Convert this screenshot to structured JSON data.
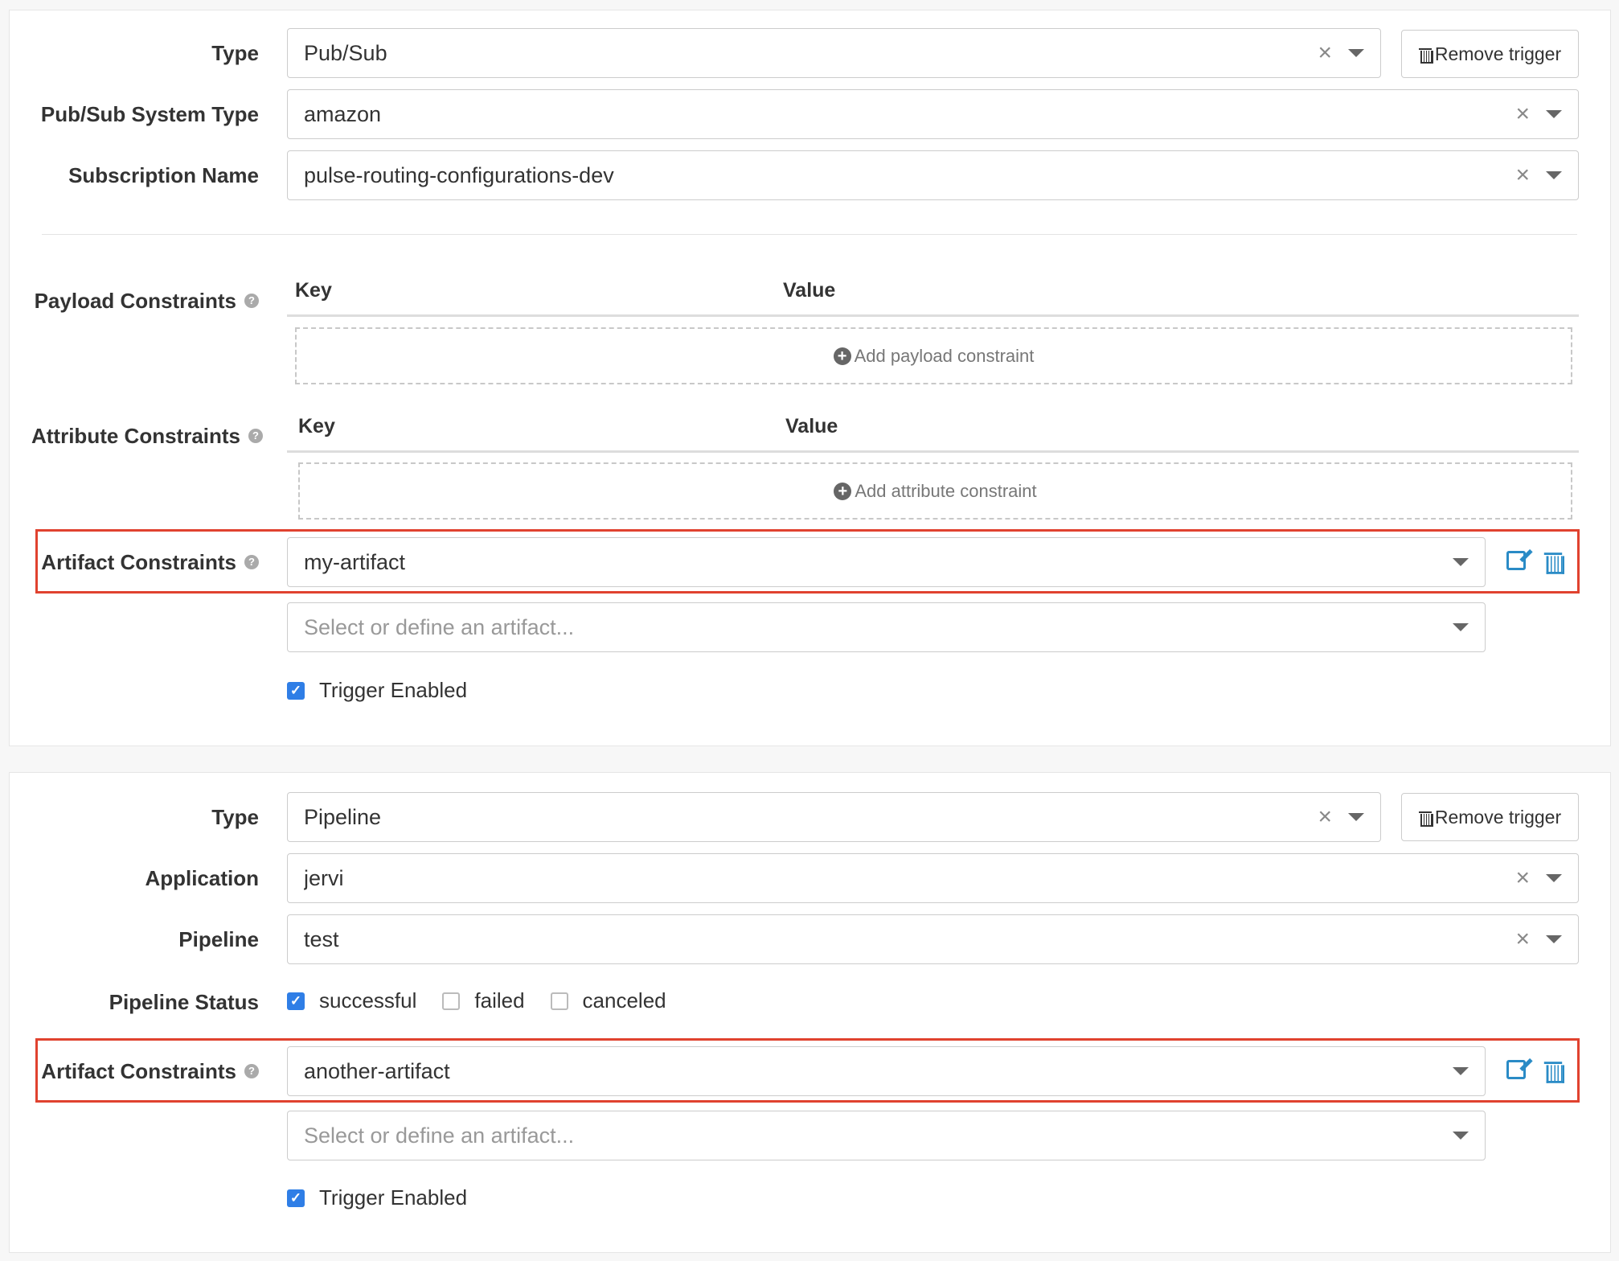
{
  "trigger1": {
    "type_label": "Type",
    "type_value": "Pub/Sub",
    "remove_label": "Remove trigger",
    "pubsub_type_label": "Pub/Sub System Type",
    "pubsub_type_value": "amazon",
    "subscription_label": "Subscription Name",
    "subscription_value": "pulse-routing-configurations-dev",
    "payload_label": "Payload Constraints",
    "payload_key_header": "Key",
    "payload_value_header": "Value",
    "add_payload_label": "Add payload constraint",
    "attribute_label": "Attribute Constraints",
    "attribute_key_header": "Key",
    "attribute_value_header": "Value",
    "add_attribute_label": "Add attribute constraint",
    "artifact_label": "Artifact Constraints",
    "artifact_value": "my-artifact",
    "artifact_placeholder": "Select or define an artifact...",
    "enabled_label": "Trigger Enabled"
  },
  "trigger2": {
    "type_label": "Type",
    "type_value": "Pipeline",
    "remove_label": "Remove trigger",
    "application_label": "Application",
    "application_value": "jervi",
    "pipeline_label": "Pipeline",
    "pipeline_value": "test",
    "status_label": "Pipeline Status",
    "status_options": [
      {
        "label": "successful",
        "checked": true
      },
      {
        "label": "failed",
        "checked": false
      },
      {
        "label": "canceled",
        "checked": false
      }
    ],
    "artifact_label": "Artifact Constraints",
    "artifact_value": "another-artifact",
    "artifact_placeholder": "Select or define an artifact...",
    "enabled_label": "Trigger Enabled"
  },
  "icons": {
    "clear": "×",
    "help": "?",
    "plus": "+",
    "check": "✓"
  },
  "colors": {
    "highlight": "#e0422f",
    "accent": "#2a8bc6",
    "checkbox": "#2f7ee6"
  }
}
